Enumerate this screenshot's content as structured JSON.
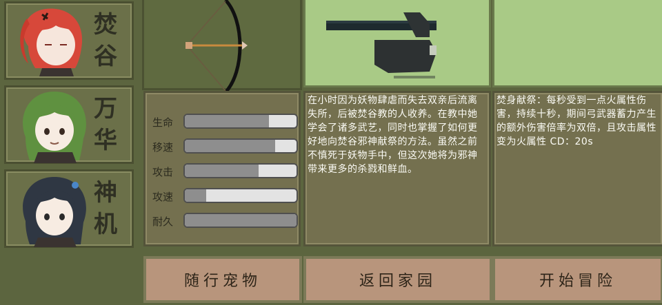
{
  "characters": [
    {
      "name": "焚谷",
      "hair_color": "#d7483a"
    },
    {
      "name": "万华",
      "hair_color": "#5f9140"
    },
    {
      "name": "神机",
      "hair_color": "#2f3743"
    }
  ],
  "stats": [
    {
      "label": "生命",
      "value": 0.75
    },
    {
      "label": "移速",
      "value": 0.81
    },
    {
      "label": "攻击",
      "value": 0.66
    },
    {
      "label": "攻速",
      "value": 0.19
    },
    {
      "label": "耐久",
      "value": 1.0
    }
  ],
  "story": "在小时因为妖物肆虐而失去双亲后流离失所，后被焚谷教的人收养。在教中她学会了诸多武艺，同时也掌握了如何更好地向焚谷邪神献祭的方法。虽然之前不慎死于妖物手中，但这次她将为邪神带来更多的杀戮和鲜血。",
  "skill": "焚身献祭：每秒受到一点火属性伤害，持续十秒，期间弓武器蓄力产生的额外伤害倍率为双倍，且攻击属性变为火属性 CD：20s",
  "buttons": {
    "pet": "随行宠物",
    "home": "返回家园",
    "start": "开始冒险"
  },
  "icons": {
    "weapon": "bow-icon",
    "pet": "duck-cannon-icon"
  },
  "colors": {
    "background": "#5c653f",
    "panel_green": "#a9ca86",
    "panel_brown": "#74704f",
    "button": "#b8957c"
  }
}
